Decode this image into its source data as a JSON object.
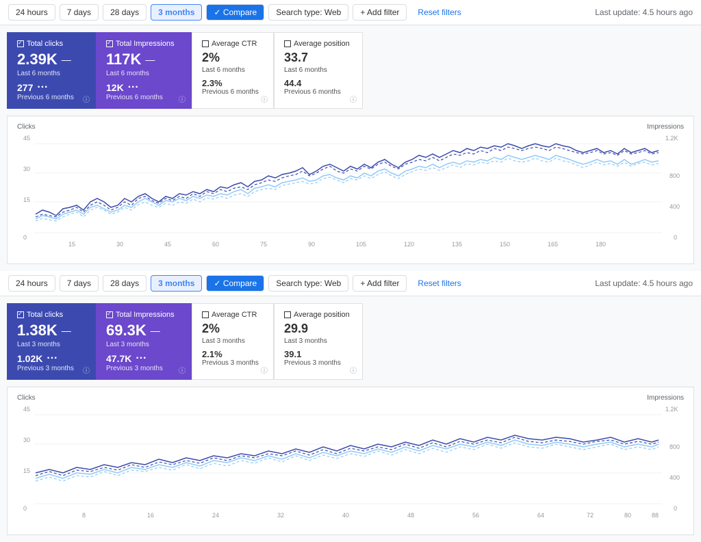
{
  "toolbar1": {
    "buttons": [
      "24 hours",
      "7 days",
      "28 days",
      "3 months"
    ],
    "active": "3 months",
    "compare_label": "✓ Compare",
    "search_type_label": "Search type: Web",
    "add_filter_label": "+ Add filter",
    "reset_label": "Reset filters",
    "last_update": "Last update: 4.5 hours ago"
  },
  "toolbar2": {
    "buttons": [
      "24 hours",
      "7 days",
      "28 days",
      "3 months"
    ],
    "active": "3 months",
    "compare_label": "✓ Compare",
    "search_type_label": "Search type: Web",
    "add_filter_label": "+ Add filter",
    "reset_label": "Reset filters",
    "last_update": "Last update: 4.5 hours ago"
  },
  "section1": {
    "metrics": [
      {
        "id": "total-clicks",
        "title": "Total clicks",
        "checked": true,
        "value": "2.39K",
        "period": "Last 6 months",
        "prev_value": "277",
        "prev_period": "Previous 6 months",
        "theme": "blue"
      },
      {
        "id": "total-impressions",
        "title": "Total Impressions",
        "checked": true,
        "value": "117K",
        "period": "Last 6 months",
        "prev_value": "12K",
        "prev_period": "Previous 6 months",
        "theme": "purple"
      },
      {
        "id": "average-ctr",
        "title": "Average CTR",
        "checked": false,
        "value": "2%",
        "period": "Last 6 months",
        "prev_value": "2.3%",
        "prev_period": "Previous 6 months",
        "theme": "white"
      },
      {
        "id": "average-position",
        "title": "Average position",
        "checked": false,
        "value": "33.7",
        "period": "Last 6 months",
        "prev_value": "44.4",
        "prev_period": "Previous 6 months",
        "theme": "white"
      }
    ],
    "chart": {
      "y_label_left": "Clicks",
      "y_label_right": "Impressions",
      "y_max_left": 45,
      "y_max_right": "1.2K",
      "x_ticks": [
        15,
        30,
        45,
        60,
        75,
        90,
        105,
        120,
        135,
        150,
        165,
        180
      ]
    }
  },
  "section2": {
    "metrics": [
      {
        "id": "total-clicks-2",
        "title": "Total clicks",
        "checked": true,
        "value": "1.38K",
        "period": "Last 3 months",
        "prev_value": "1.02K",
        "prev_period": "Previous 3 months",
        "theme": "blue"
      },
      {
        "id": "total-impressions-2",
        "title": "Total Impressions",
        "checked": true,
        "value": "69.3K",
        "period": "Last 3 months",
        "prev_value": "47.7K",
        "prev_period": "Previous 3 months",
        "theme": "purple"
      },
      {
        "id": "average-ctr-2",
        "title": "Average CTR",
        "checked": false,
        "value": "2%",
        "period": "Last 3 months",
        "prev_value": "2.1%",
        "prev_period": "Previous 3 months",
        "theme": "white"
      },
      {
        "id": "average-position-2",
        "title": "Average position",
        "checked": false,
        "value": "29.9",
        "period": "Last 3 months",
        "prev_value": "39.1",
        "prev_period": "Previous 3 months",
        "theme": "white"
      }
    ],
    "chart": {
      "y_label_left": "Clicks",
      "y_label_right": "Impressions",
      "y_max_left": 45,
      "y_max_right": "1.2K",
      "x_ticks": [
        8,
        16,
        24,
        32,
        40,
        48,
        56,
        64,
        72,
        80,
        88
      ]
    }
  }
}
